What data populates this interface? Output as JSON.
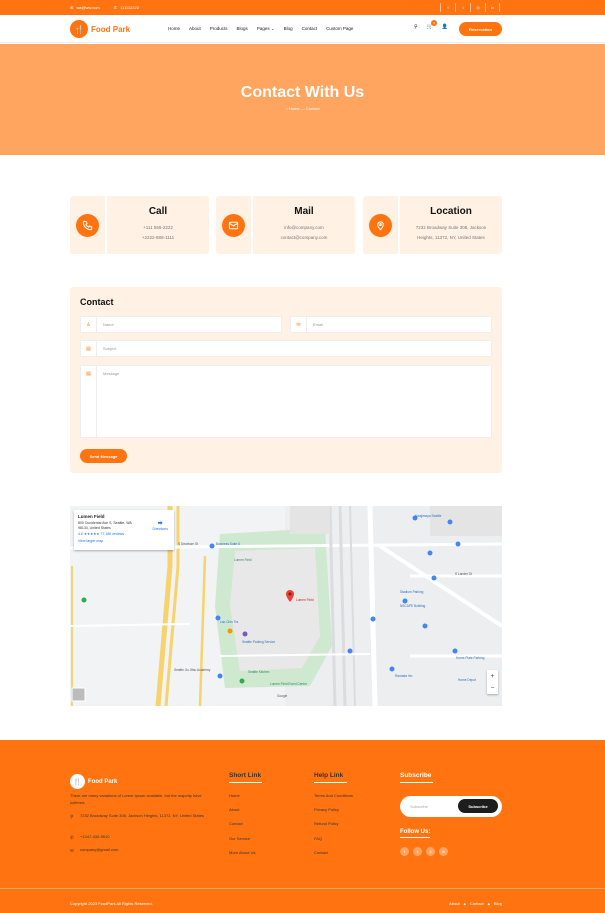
{
  "colors": {
    "accent": "#ff7410",
    "hero_bg": "#ffa55f",
    "card_bg": "#fff1e4",
    "dark": "#1d1d1d"
  },
  "topbar": {
    "email": "wa@ww.com",
    "phone": "111112222",
    "social_icons": [
      "facebook-icon",
      "twitter-icon",
      "instagram-icon",
      "linkedin-icon"
    ],
    "social_glyphs": [
      "f",
      "t",
      "◎",
      "in"
    ]
  },
  "header": {
    "logo_text": "Food Park",
    "nav": [
      "Home",
      "About",
      "Products",
      "Blogs",
      "Pages",
      "Blog",
      "Contact",
      "Custom Page"
    ],
    "cart_count": "0",
    "reservation_label": "Reservation"
  },
  "hero": {
    "title": "Contact With Us",
    "breadcrumb_home": "Home",
    "breadcrumb_sep": "—",
    "breadcrumb_current": "Contact"
  },
  "cards": [
    {
      "icon": "phone-icon",
      "title": "Call",
      "lines": [
        "+111 555-2222",
        "+2222-888-1111"
      ]
    },
    {
      "icon": "mail-icon",
      "title": "Mail",
      "lines": [
        "info@company.com",
        "contact@company.com"
      ]
    },
    {
      "icon": "location-icon",
      "title": "Location",
      "lines": [
        "7232 Broadway Suite 308, Jackson",
        "Heights, 11372, NY, United States"
      ]
    }
  ],
  "form": {
    "title": "Contact",
    "name_placeholder": "Name",
    "email_placeholder": "Email",
    "subject_placeholder": "Subject",
    "message_placeholder": "Message",
    "send_label": "Send Message"
  },
  "map": {
    "place_title": "Lumen Field",
    "place_address": "800 Occidental Ave S, Seattle, WA 98134, United States",
    "rating": "4.6 ★★★★★",
    "reviews": "77,180 reviews",
    "directions": "Directions",
    "larger_map": "View larger map",
    "pin_label": "Lumen Field",
    "labels": [
      "S Dearborn St",
      "Business Suite 8",
      "Lumen Field",
      "Lao Chin Tra",
      "Seattle Parking Service",
      "Seattle Kitchen",
      "Lumen Field Event Center",
      "Seattle Jiu Jitsu Academy",
      "Google",
      "Stadium Parking",
      "NSCAPE Building",
      "Home Depot",
      "Ramada Inn",
      "Safeco Field",
      "Seattle Marriott",
      "S Lander St",
      "Uwajimaya Seattle",
      "4th Ave S",
      "Alaskan Way S",
      "1st Ave S",
      "Edgar Martinez Dr S",
      "Home Plate Parking",
      "Shake Shack",
      "Keys to the City",
      "Occidental Park",
      "5th Ave S",
      "Airport Way S",
      "Qdoba",
      "Terms",
      "Report a map error",
      "Keyboard shortcuts",
      "Map data ©2023 Google"
    ]
  },
  "footer": {
    "logo_text": "Food Park",
    "about": "There are many variations of Lorem Ipsum available, but the majority have suffered.",
    "address": "7232 Broadway Suite 308, Jackson Heights, 11372, NY, United States",
    "phone": "+1347-430-9510",
    "email": "company@gmail.com",
    "short_link_title": "Short Link",
    "short_links": [
      "Home",
      "About",
      "Contact",
      "Our Service",
      "More About Us"
    ],
    "help_link_title": "Help Link",
    "help_links": [
      "Terms And Conditions",
      "Privacy Policy",
      "Refund Policy",
      "FAQ",
      "Contact"
    ],
    "subscribe_title": "Subscribe",
    "subscribe_placeholder": "Subscribe",
    "subscribe_button": "Subscribe",
    "follow_title": "Follow Us:",
    "social_icons": [
      "facebook-icon",
      "twitter-icon",
      "instagram-icon",
      "linkedin-icon"
    ],
    "social_glyphs": [
      "f",
      "t",
      "◎",
      "in"
    ],
    "copyright": "Copyright 2023 FoodPark All Rights Reserved.",
    "bottom_links": [
      "About",
      "Contact",
      "Blog"
    ]
  }
}
